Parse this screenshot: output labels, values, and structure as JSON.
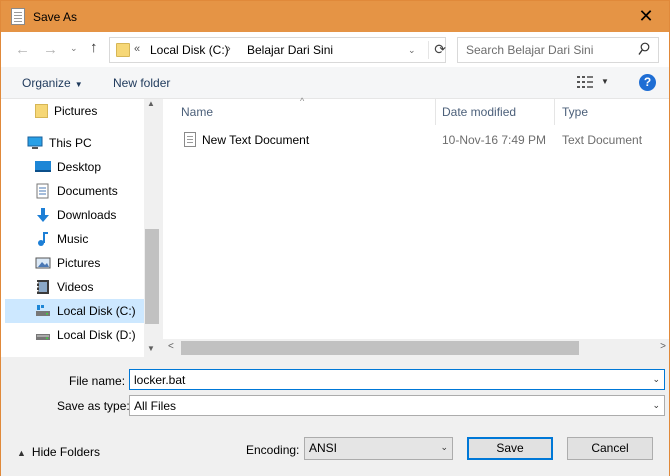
{
  "window": {
    "title": "Save As",
    "close_glyph": "✕"
  },
  "nav": {
    "back": "←",
    "forward": "→",
    "recent": "⌄",
    "up": "↑"
  },
  "address": {
    "overflow": "«",
    "path": [
      "Local Disk (C:)",
      "Belajar Dari Sini"
    ],
    "separator": "›",
    "dropdown": "⌄",
    "refresh": "⟳"
  },
  "search": {
    "placeholder": "Search Belajar Dari Sini"
  },
  "toolbar": {
    "organize_label": "Organize",
    "organize_dd": "▼",
    "new_folder_label": "New folder",
    "view_dd": "▼",
    "help": "?"
  },
  "sidebar": {
    "items": [
      {
        "label": "Pictures",
        "icon": "folder-icon"
      },
      {
        "label": "This PC",
        "icon": "computer-icon"
      },
      {
        "label": "Desktop",
        "icon": "desktop-icon"
      },
      {
        "label": "Documents",
        "icon": "documents-icon"
      },
      {
        "label": "Downloads",
        "icon": "downloads-icon"
      },
      {
        "label": "Music",
        "icon": "music-icon"
      },
      {
        "label": "Pictures",
        "icon": "pictures-icon"
      },
      {
        "label": "Videos",
        "icon": "videos-icon"
      },
      {
        "label": "Local Disk (C:)",
        "icon": "drive-icon",
        "selected": true
      },
      {
        "label": "Local Disk (D:)",
        "icon": "drive-icon"
      }
    ],
    "scroll_up": "▲",
    "scroll_down": "▼"
  },
  "files": {
    "columns": [
      "Name",
      "Date modified",
      "Type"
    ],
    "sort_glyph": "^",
    "rows": [
      {
        "name": "New Text Document",
        "date": "10-Nov-16 7:49 PM",
        "type": "Text Document"
      }
    ],
    "scroll_left": "<",
    "scroll_right": ">"
  },
  "form": {
    "file_name_label": "File name:",
    "file_name_value": "locker.bat",
    "save_type_label": "Save as type:",
    "save_type_value": "All Files",
    "dd_glyph": "⌄",
    "hide_folders_label": "Hide Folders",
    "hide_folders_caret": "▲",
    "encoding_label": "Encoding:",
    "encoding_value": "ANSI",
    "save_label": "Save",
    "cancel_label": "Cancel"
  },
  "colors": {
    "titlebar": "#e59445",
    "accent": "#0078d7",
    "selection": "#cde8ff"
  }
}
